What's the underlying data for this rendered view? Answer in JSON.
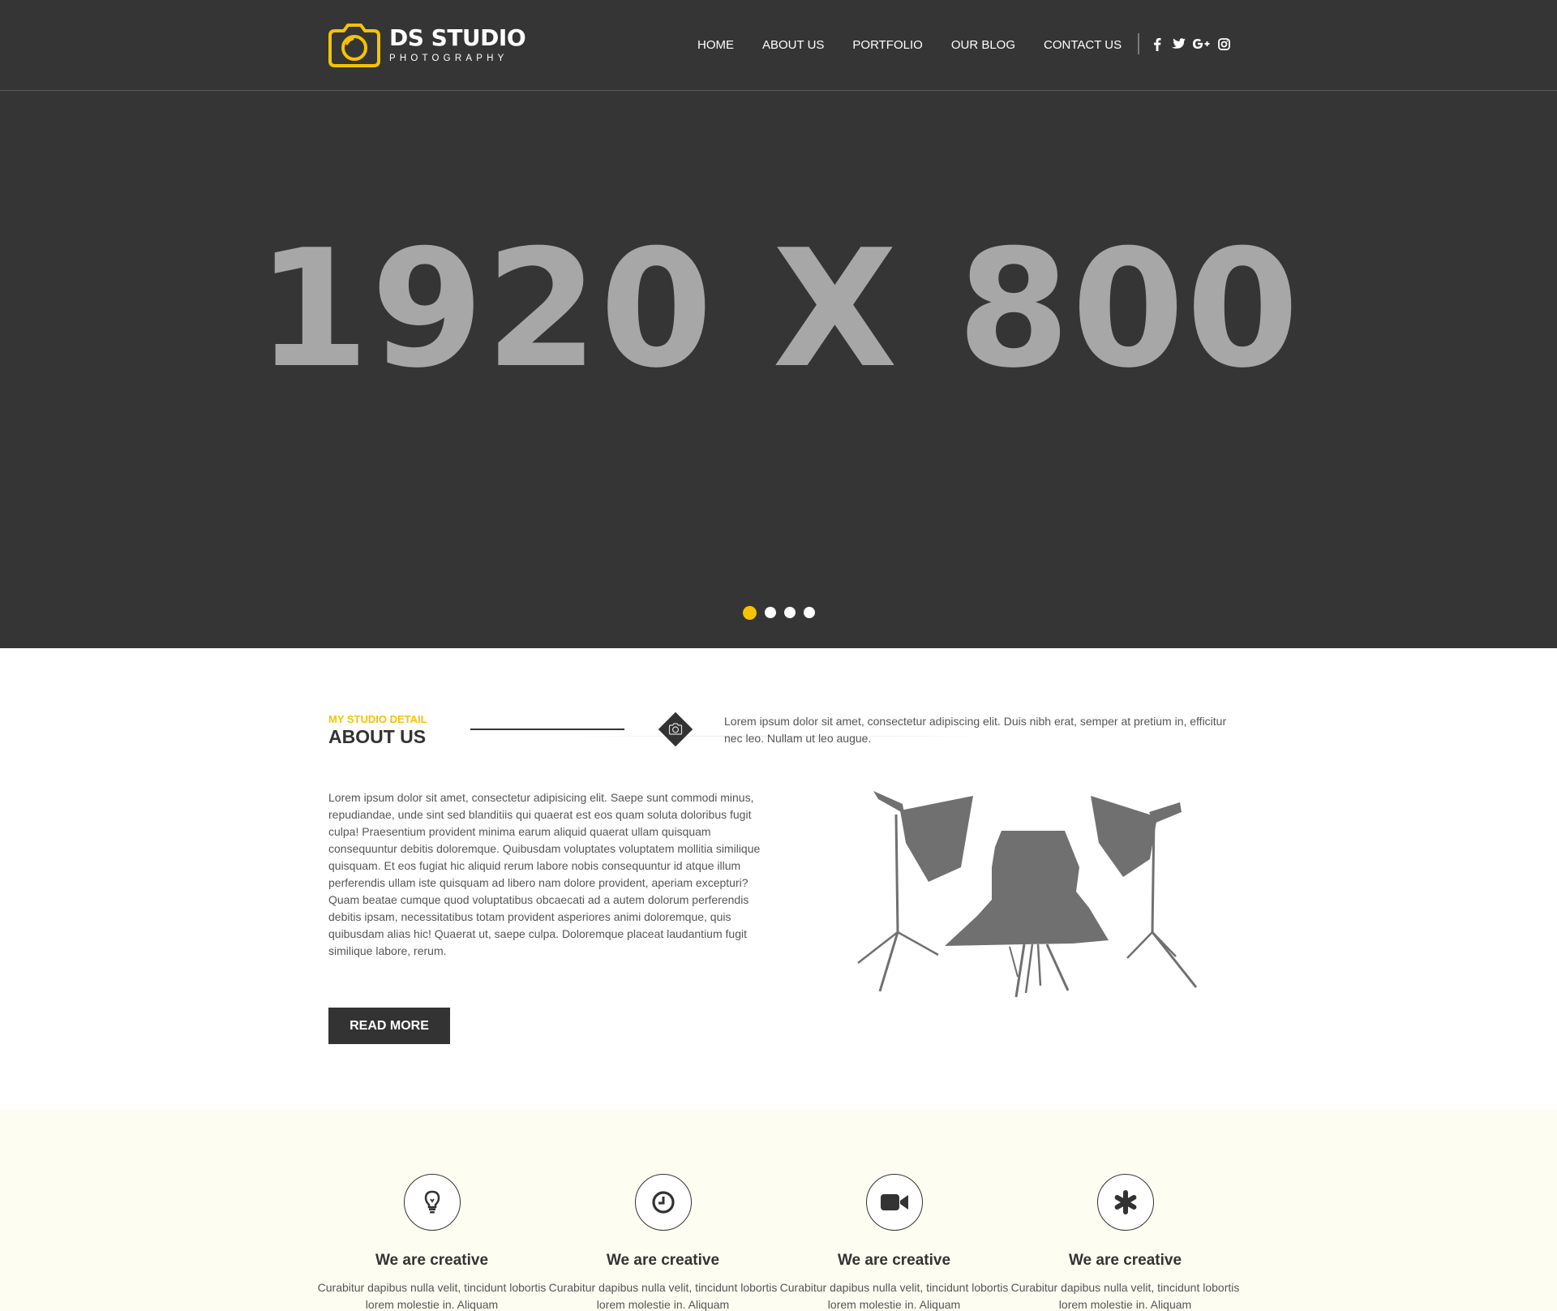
{
  "brand": {
    "title": "DS STUDIO",
    "subtitle": "PHOTOGRAPHY",
    "accent_color": "#f5c300",
    "icon": "camera-icon"
  },
  "nav": {
    "items": [
      {
        "label": "HOME"
      },
      {
        "label": "ABOUT US"
      },
      {
        "label": "PORTFOLIO"
      },
      {
        "label": "OUR BLOG"
      },
      {
        "label": "CONTACT US"
      }
    ]
  },
  "social": [
    {
      "icon": "facebook-icon",
      "glyph": "f"
    },
    {
      "icon": "twitter-icon",
      "glyph": "t"
    },
    {
      "icon": "google-plus-icon",
      "glyph": "G+"
    },
    {
      "icon": "instagram-icon",
      "glyph": "◎"
    }
  ],
  "hero": {
    "text": "1920 X 800",
    "slide_count": 4,
    "active_slide": 1
  },
  "about": {
    "kicker": "MY STUDIO DETAIL",
    "title": "ABOUT US",
    "lede": "Lorem ipsum dolor sit amet, consectetur adipiscing elit. Duis nibh erat, semper at pretium in, efficitur nec leo. Nullam ut leo augue.",
    "body": "Lorem ipsum dolor sit amet, consectetur adipisicing elit. Saepe sunt commodi minus, repudiandae, unde sint sed blanditiis qui quaerat est eos quam soluta doloribus fugit culpa! Praesentium provident minima earum aliquid quaerat ullam quisquam consequuntur debitis doloremque. Quibusdam voluptates voluptatem mollitia similique quisquam. Et eos fugiat hic aliquid rerum labore nobis consequuntur id atque illum perferendis ullam iste quisquam ad libero nam dolore provident, aperiam excepturi? Quam beatae cumque quod voluptatibus obcaecati ad a autem dolorum perferendis debitis ipsam, necessitatibus totam provident asperiores animi doloremque, quis quibusdam alias hic! Quaerat ut, saepe culpa. Doloremque placeat laudantium fugit similique labore, rerum.",
    "button_label": "READ MORE",
    "illustration": "photo-studio-illustration"
  },
  "features": [
    {
      "icon": "lightbulb-icon",
      "title": "We are creative",
      "text": "Curabitur dapibus nulla velit, tincidunt lobortis lorem molestie in. Aliquam"
    },
    {
      "icon": "clock-icon",
      "title": "We are creative",
      "text": "Curabitur dapibus nulla velit, tincidunt lobortis lorem molestie in. Aliquam"
    },
    {
      "icon": "video-camera-icon",
      "title": "We are creative",
      "text": "Curabitur dapibus nulla velit, tincidunt lobortis lorem molestie in. Aliquam"
    },
    {
      "icon": "asterisk-icon",
      "title": "We are creative",
      "text": "Curabitur dapibus nulla velit, tincidunt lobortis lorem molestie in. Aliquam"
    }
  ]
}
